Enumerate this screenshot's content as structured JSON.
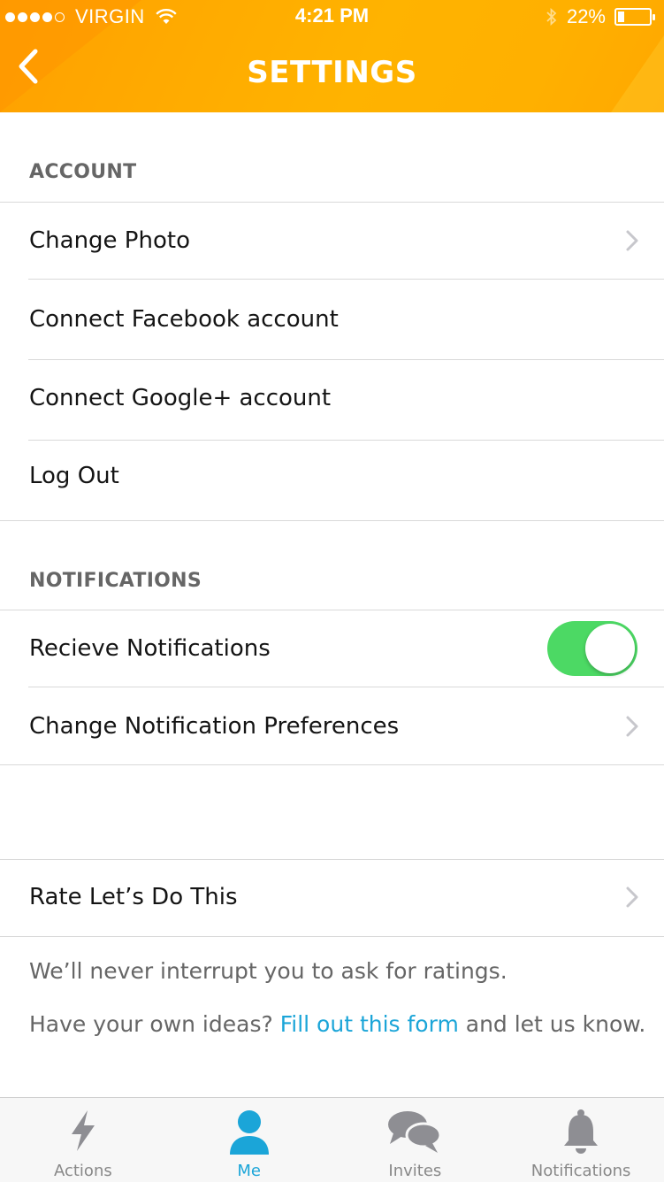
{
  "status_bar": {
    "carrier": "VIRGIN",
    "time": "4:21 PM",
    "battery_percent_label": "22%",
    "battery_level": 0.22
  },
  "header": {
    "title": "SETTINGS",
    "back_icon": "chevron-left-icon"
  },
  "sections": {
    "account": {
      "header": "ACCOUNT",
      "items": [
        {
          "label": "Change Photo",
          "chevron": true
        },
        {
          "label": "Connect Facebook account",
          "chevron": false
        },
        {
          "label": "Connect Google+ account",
          "chevron": false
        },
        {
          "label": "Log Out",
          "chevron": false
        }
      ]
    },
    "notifications": {
      "header": "NOTIFICATIONS",
      "receive_label": "Recieve Notifications",
      "receive_on": true,
      "preferences_label": "Change Notification Preferences"
    },
    "rate": {
      "label": "Rate Let’s Do This",
      "info_line1": "We’ll never interrupt you to ask for ratings.",
      "info_line2_before": "Have your own ideas?",
      "info_link": "Fill out this form",
      "info_line2_after": "and let us know."
    }
  },
  "tab_bar": {
    "tabs": [
      {
        "label": "Actions",
        "icon": "lightning-bolt-icon",
        "active": false
      },
      {
        "label": "Me",
        "icon": "person-icon",
        "active": true
      },
      {
        "label": "Invites",
        "icon": "chat-bubbles-icon",
        "active": false
      },
      {
        "label": "Notifications",
        "icon": "bell-icon",
        "active": false
      }
    ]
  },
  "colors": {
    "header": "#ffb000",
    "accent": "#1ba5d8",
    "toggle_on": "#4cd964"
  }
}
